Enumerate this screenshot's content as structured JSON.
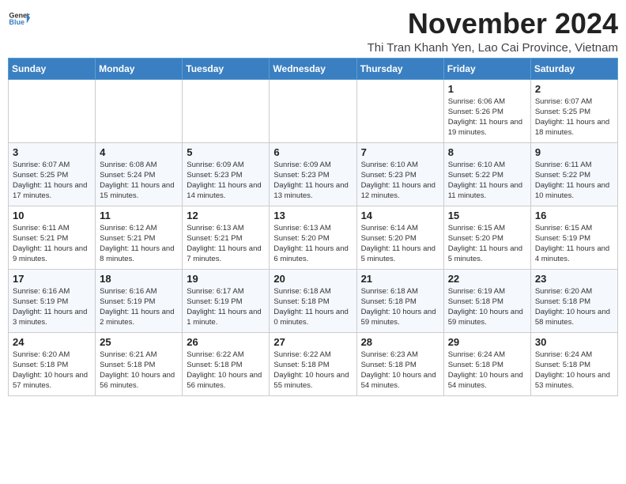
{
  "header": {
    "logo_general": "General",
    "logo_blue": "Blue",
    "month_title": "November 2024",
    "subtitle": "Thi Tran Khanh Yen, Lao Cai Province, Vietnam"
  },
  "weekdays": [
    "Sunday",
    "Monday",
    "Tuesday",
    "Wednesday",
    "Thursday",
    "Friday",
    "Saturday"
  ],
  "weeks": [
    [
      {
        "day": "",
        "info": ""
      },
      {
        "day": "",
        "info": ""
      },
      {
        "day": "",
        "info": ""
      },
      {
        "day": "",
        "info": ""
      },
      {
        "day": "",
        "info": ""
      },
      {
        "day": "1",
        "info": "Sunrise: 6:06 AM\nSunset: 5:26 PM\nDaylight: 11 hours and 19 minutes."
      },
      {
        "day": "2",
        "info": "Sunrise: 6:07 AM\nSunset: 5:25 PM\nDaylight: 11 hours and 18 minutes."
      }
    ],
    [
      {
        "day": "3",
        "info": "Sunrise: 6:07 AM\nSunset: 5:25 PM\nDaylight: 11 hours and 17 minutes."
      },
      {
        "day": "4",
        "info": "Sunrise: 6:08 AM\nSunset: 5:24 PM\nDaylight: 11 hours and 15 minutes."
      },
      {
        "day": "5",
        "info": "Sunrise: 6:09 AM\nSunset: 5:23 PM\nDaylight: 11 hours and 14 minutes."
      },
      {
        "day": "6",
        "info": "Sunrise: 6:09 AM\nSunset: 5:23 PM\nDaylight: 11 hours and 13 minutes."
      },
      {
        "day": "7",
        "info": "Sunrise: 6:10 AM\nSunset: 5:23 PM\nDaylight: 11 hours and 12 minutes."
      },
      {
        "day": "8",
        "info": "Sunrise: 6:10 AM\nSunset: 5:22 PM\nDaylight: 11 hours and 11 minutes."
      },
      {
        "day": "9",
        "info": "Sunrise: 6:11 AM\nSunset: 5:22 PM\nDaylight: 11 hours and 10 minutes."
      }
    ],
    [
      {
        "day": "10",
        "info": "Sunrise: 6:11 AM\nSunset: 5:21 PM\nDaylight: 11 hours and 9 minutes."
      },
      {
        "day": "11",
        "info": "Sunrise: 6:12 AM\nSunset: 5:21 PM\nDaylight: 11 hours and 8 minutes."
      },
      {
        "day": "12",
        "info": "Sunrise: 6:13 AM\nSunset: 5:21 PM\nDaylight: 11 hours and 7 minutes."
      },
      {
        "day": "13",
        "info": "Sunrise: 6:13 AM\nSunset: 5:20 PM\nDaylight: 11 hours and 6 minutes."
      },
      {
        "day": "14",
        "info": "Sunrise: 6:14 AM\nSunset: 5:20 PM\nDaylight: 11 hours and 5 minutes."
      },
      {
        "day": "15",
        "info": "Sunrise: 6:15 AM\nSunset: 5:20 PM\nDaylight: 11 hours and 5 minutes."
      },
      {
        "day": "16",
        "info": "Sunrise: 6:15 AM\nSunset: 5:19 PM\nDaylight: 11 hours and 4 minutes."
      }
    ],
    [
      {
        "day": "17",
        "info": "Sunrise: 6:16 AM\nSunset: 5:19 PM\nDaylight: 11 hours and 3 minutes."
      },
      {
        "day": "18",
        "info": "Sunrise: 6:16 AM\nSunset: 5:19 PM\nDaylight: 11 hours and 2 minutes."
      },
      {
        "day": "19",
        "info": "Sunrise: 6:17 AM\nSunset: 5:19 PM\nDaylight: 11 hours and 1 minute."
      },
      {
        "day": "20",
        "info": "Sunrise: 6:18 AM\nSunset: 5:18 PM\nDaylight: 11 hours and 0 minutes."
      },
      {
        "day": "21",
        "info": "Sunrise: 6:18 AM\nSunset: 5:18 PM\nDaylight: 10 hours and 59 minutes."
      },
      {
        "day": "22",
        "info": "Sunrise: 6:19 AM\nSunset: 5:18 PM\nDaylight: 10 hours and 59 minutes."
      },
      {
        "day": "23",
        "info": "Sunrise: 6:20 AM\nSunset: 5:18 PM\nDaylight: 10 hours and 58 minutes."
      }
    ],
    [
      {
        "day": "24",
        "info": "Sunrise: 6:20 AM\nSunset: 5:18 PM\nDaylight: 10 hours and 57 minutes."
      },
      {
        "day": "25",
        "info": "Sunrise: 6:21 AM\nSunset: 5:18 PM\nDaylight: 10 hours and 56 minutes."
      },
      {
        "day": "26",
        "info": "Sunrise: 6:22 AM\nSunset: 5:18 PM\nDaylight: 10 hours and 56 minutes."
      },
      {
        "day": "27",
        "info": "Sunrise: 6:22 AM\nSunset: 5:18 PM\nDaylight: 10 hours and 55 minutes."
      },
      {
        "day": "28",
        "info": "Sunrise: 6:23 AM\nSunset: 5:18 PM\nDaylight: 10 hours and 54 minutes."
      },
      {
        "day": "29",
        "info": "Sunrise: 6:24 AM\nSunset: 5:18 PM\nDaylight: 10 hours and 54 minutes."
      },
      {
        "day": "30",
        "info": "Sunrise: 6:24 AM\nSunset: 5:18 PM\nDaylight: 10 hours and 53 minutes."
      }
    ]
  ]
}
